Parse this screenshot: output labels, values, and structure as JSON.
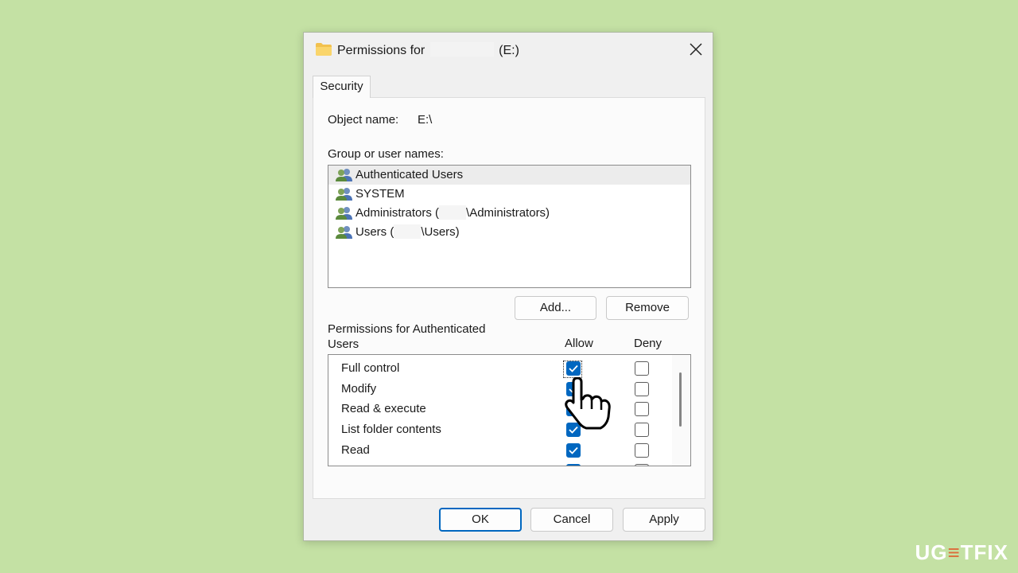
{
  "dialog": {
    "title_prefix": "Permissions for",
    "title_suffix": "(E:)",
    "tab_label": "Security",
    "object_label": "Object name:",
    "object_value": "E:\\",
    "groups_label": "Group or user names:",
    "users": [
      {
        "name_pre": "Authenticated Users",
        "name_post": "",
        "redacted": false,
        "selected": true
      },
      {
        "name_pre": "SYSTEM",
        "name_post": "",
        "redacted": false,
        "selected": false
      },
      {
        "name_pre": "Administrators (",
        "name_post": "\\Administrators)",
        "redacted": true,
        "selected": false
      },
      {
        "name_pre": "Users (",
        "name_post": "\\Users)",
        "redacted": true,
        "selected": false
      }
    ],
    "add_button": "Add...",
    "remove_button": "Remove",
    "permissions_label_line1": "Permissions for Authenticated",
    "permissions_label_line2": "Users",
    "allow_header": "Allow",
    "deny_header": "Deny",
    "permissions": [
      {
        "name": "Full control",
        "allow": true,
        "deny": false
      },
      {
        "name": "Modify",
        "allow": true,
        "deny": false
      },
      {
        "name": "Read & execute",
        "allow": true,
        "deny": false
      },
      {
        "name": "List folder contents",
        "allow": true,
        "deny": false
      },
      {
        "name": "Read",
        "allow": true,
        "deny": false
      },
      {
        "name": "",
        "allow": true,
        "deny": false
      }
    ],
    "ok_button": "OK",
    "cancel_button": "Cancel",
    "apply_button": "Apply"
  },
  "watermark": {
    "part1": "UG",
    "part2": "≡",
    "part3": "TFIX"
  },
  "colors": {
    "background": "#c4e1a4",
    "accent": "#0067c0",
    "watermark_accent": "#dc6b3a"
  }
}
